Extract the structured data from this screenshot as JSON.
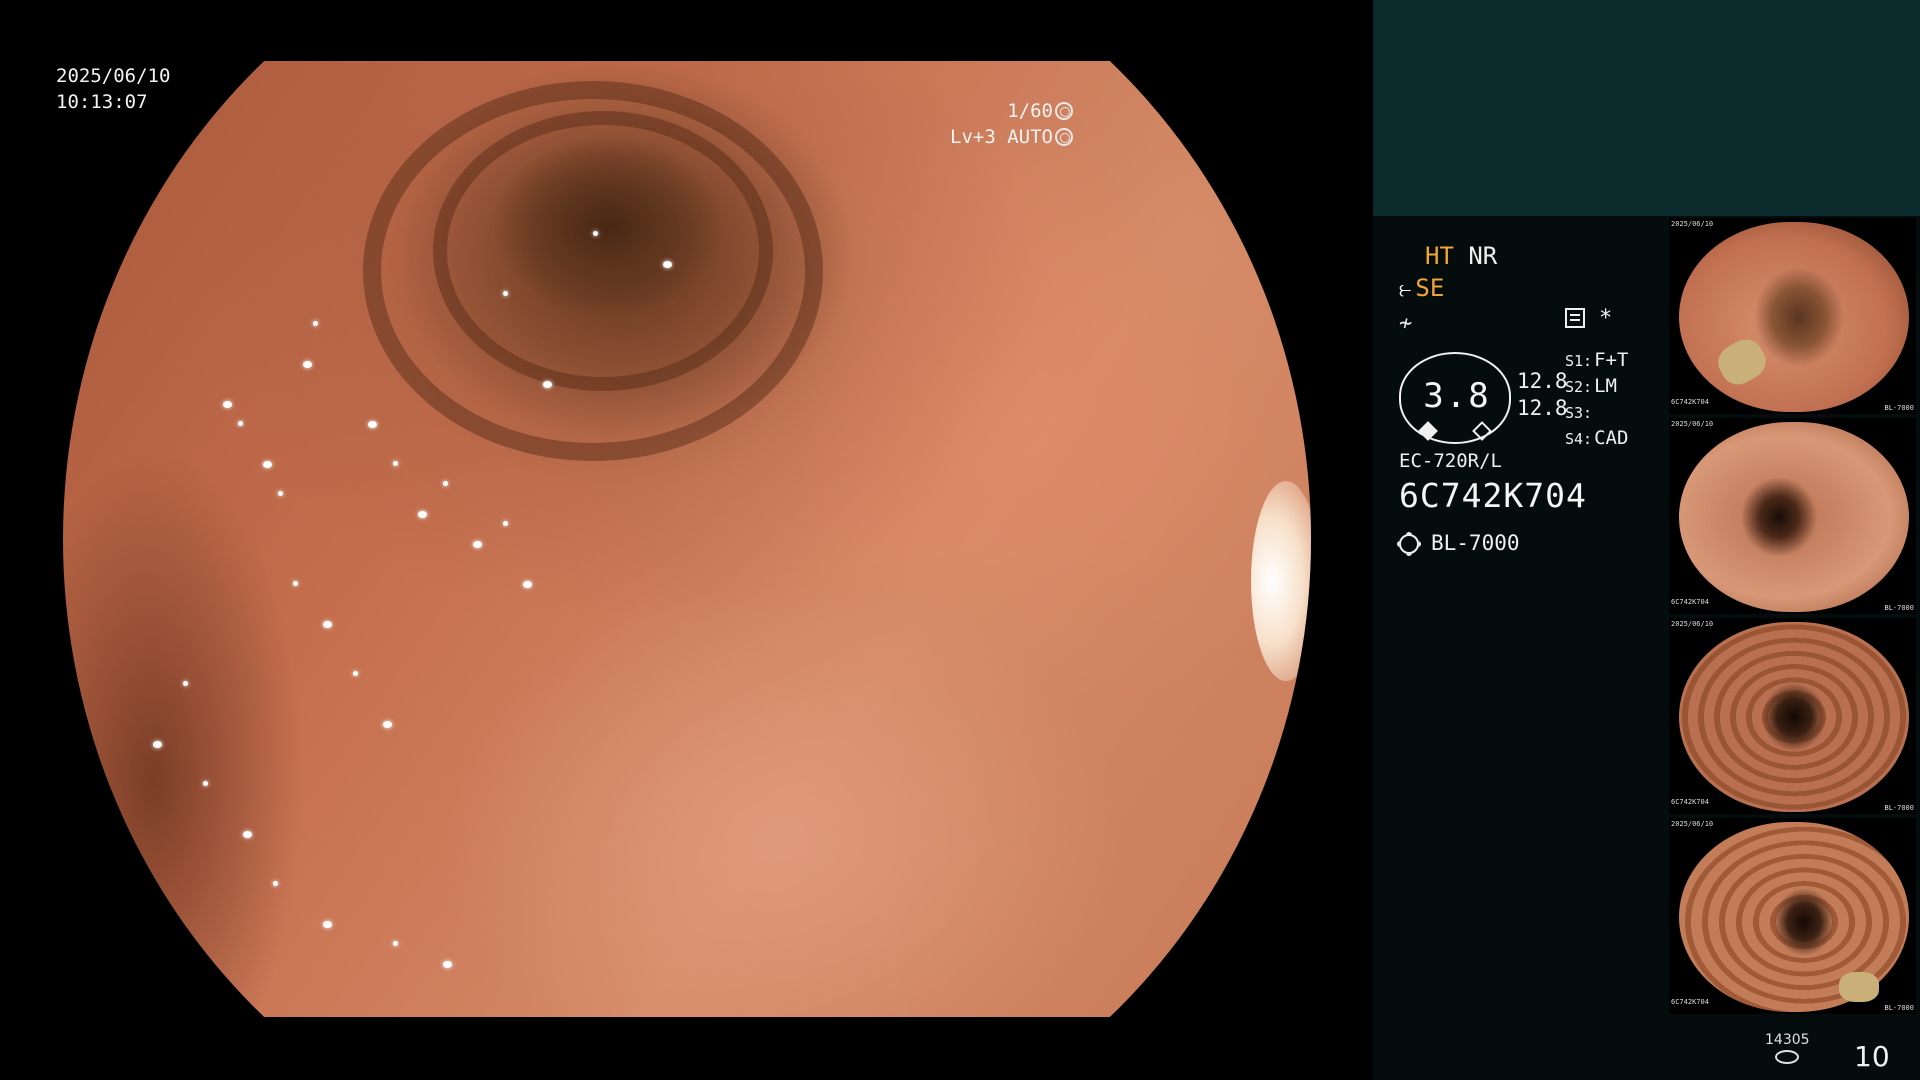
{
  "overlay": {
    "date": "2025/06/10",
    "time": "10:13:07",
    "shutter": "1/60",
    "level": "Lv+3 AUTO"
  },
  "status": {
    "ht": "HT",
    "nr": "NR",
    "se": "SE",
    "zoom": "3.8",
    "zoom_a": "12.8",
    "zoom_b": "12.8",
    "asterisk": "*",
    "switches": [
      {
        "label": "S1:",
        "value": "F+T"
      },
      {
        "label": "S2:",
        "value": "LM"
      },
      {
        "label": "S3:",
        "value": ""
      },
      {
        "label": "S4:",
        "value": "CAD"
      }
    ],
    "scope_model": "EC-720R/L",
    "scope_serial": "6C742K704",
    "light_source": "BL-7000"
  },
  "thumbnails": {
    "serial": "6C742K704",
    "light": "BL-7000",
    "date": "2025/06/10"
  },
  "footer": {
    "counter_small": "14305",
    "counter_big": "10"
  },
  "colors": {
    "accent": "#f0a53a",
    "panel": "#050c0d",
    "header": "#0b2a2c"
  }
}
